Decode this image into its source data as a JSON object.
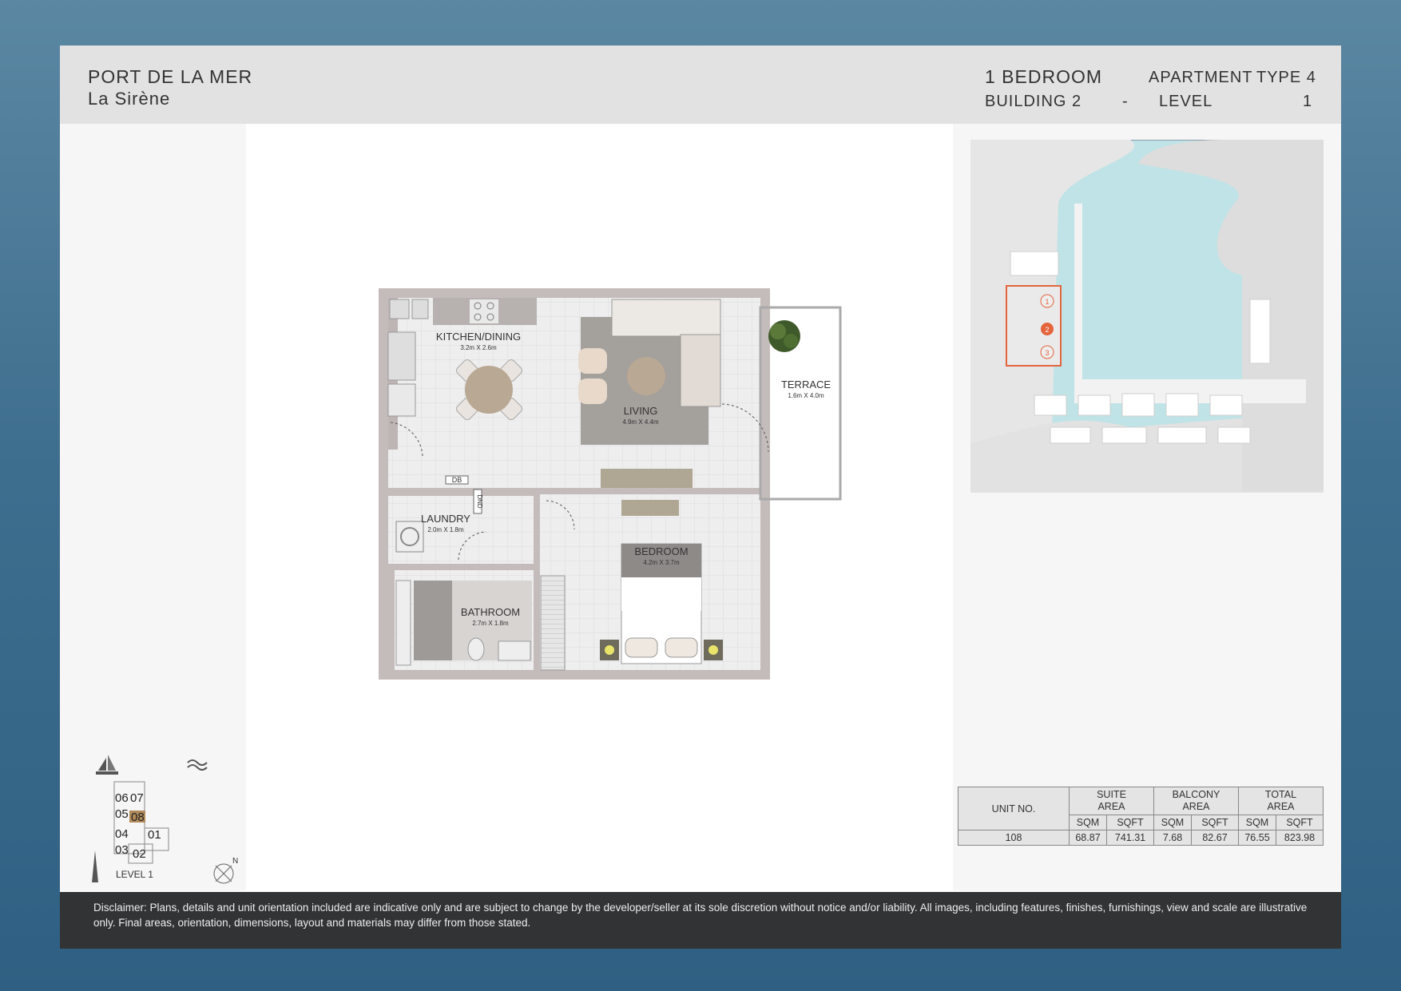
{
  "header": {
    "project": "PORT DE LA MER",
    "building_name": "La Sirène",
    "bedrooms": "1 BEDROOM",
    "apartment_label": "APARTMENT",
    "type_label": "TYPE 4",
    "building_label": "BUILDING 2",
    "separator": "-",
    "level_label": "LEVEL",
    "level_value": "1"
  },
  "plan": {
    "rooms": [
      {
        "name": "KITCHEN/DINING",
        "dims": "3.2m X 2.6m"
      },
      {
        "name": "LIVING",
        "dims": "4.9m X 4.4m"
      },
      {
        "name": "TERRACE",
        "dims": "1.6m X 4.0m"
      },
      {
        "name": "LAUNDRY",
        "dims": "2.0m X 1.8m"
      },
      {
        "name": "BEDROOM",
        "dims": "4.2m X 3.7m"
      },
      {
        "name": "BATHROOM",
        "dims": "2.7m X 1.8m"
      }
    ],
    "tags": {
      "db": "DB",
      "dnd": "DND"
    }
  },
  "site_map": {
    "buildings": [
      "1",
      "2",
      "3"
    ]
  },
  "keyplan": {
    "units": [
      "06",
      "07",
      "05",
      "08",
      "04",
      "01",
      "03",
      "02"
    ],
    "level": "LEVEL 1",
    "north": "N",
    "highlight_color": "#b08a5a"
  },
  "areas": {
    "headers": {
      "unit": "UNIT NO.",
      "suite": [
        "SUITE",
        "AREA"
      ],
      "balcony": [
        "BALCONY",
        "AREA"
      ],
      "total": [
        "TOTAL",
        "AREA"
      ],
      "sqm": "SQM",
      "sqft": "SQFT"
    },
    "row": {
      "unit": "108",
      "suite_sqm": "68.87",
      "suite_sqft": "741.31",
      "balcony_sqm": "7.68",
      "balcony_sqft": "82.67",
      "total_sqm": "76.55",
      "total_sqft": "823.98"
    }
  },
  "disclaimer": "Disclaimer: Plans, details and unit orientation included are indicative only and are subject to change by the developer/seller at its sole discretion without notice and/or liability. All images, including features, finishes, furnishings, view and scale are illustrative only. Final areas, orientation, dimensions, layout and materials may differ from those stated.",
  "colors": {
    "header_bg": "#e2e2e2",
    "footer_bg": "#323335",
    "wall": "#c4bcba",
    "water": "#bfe3e6",
    "highlight": "#e4643c"
  }
}
